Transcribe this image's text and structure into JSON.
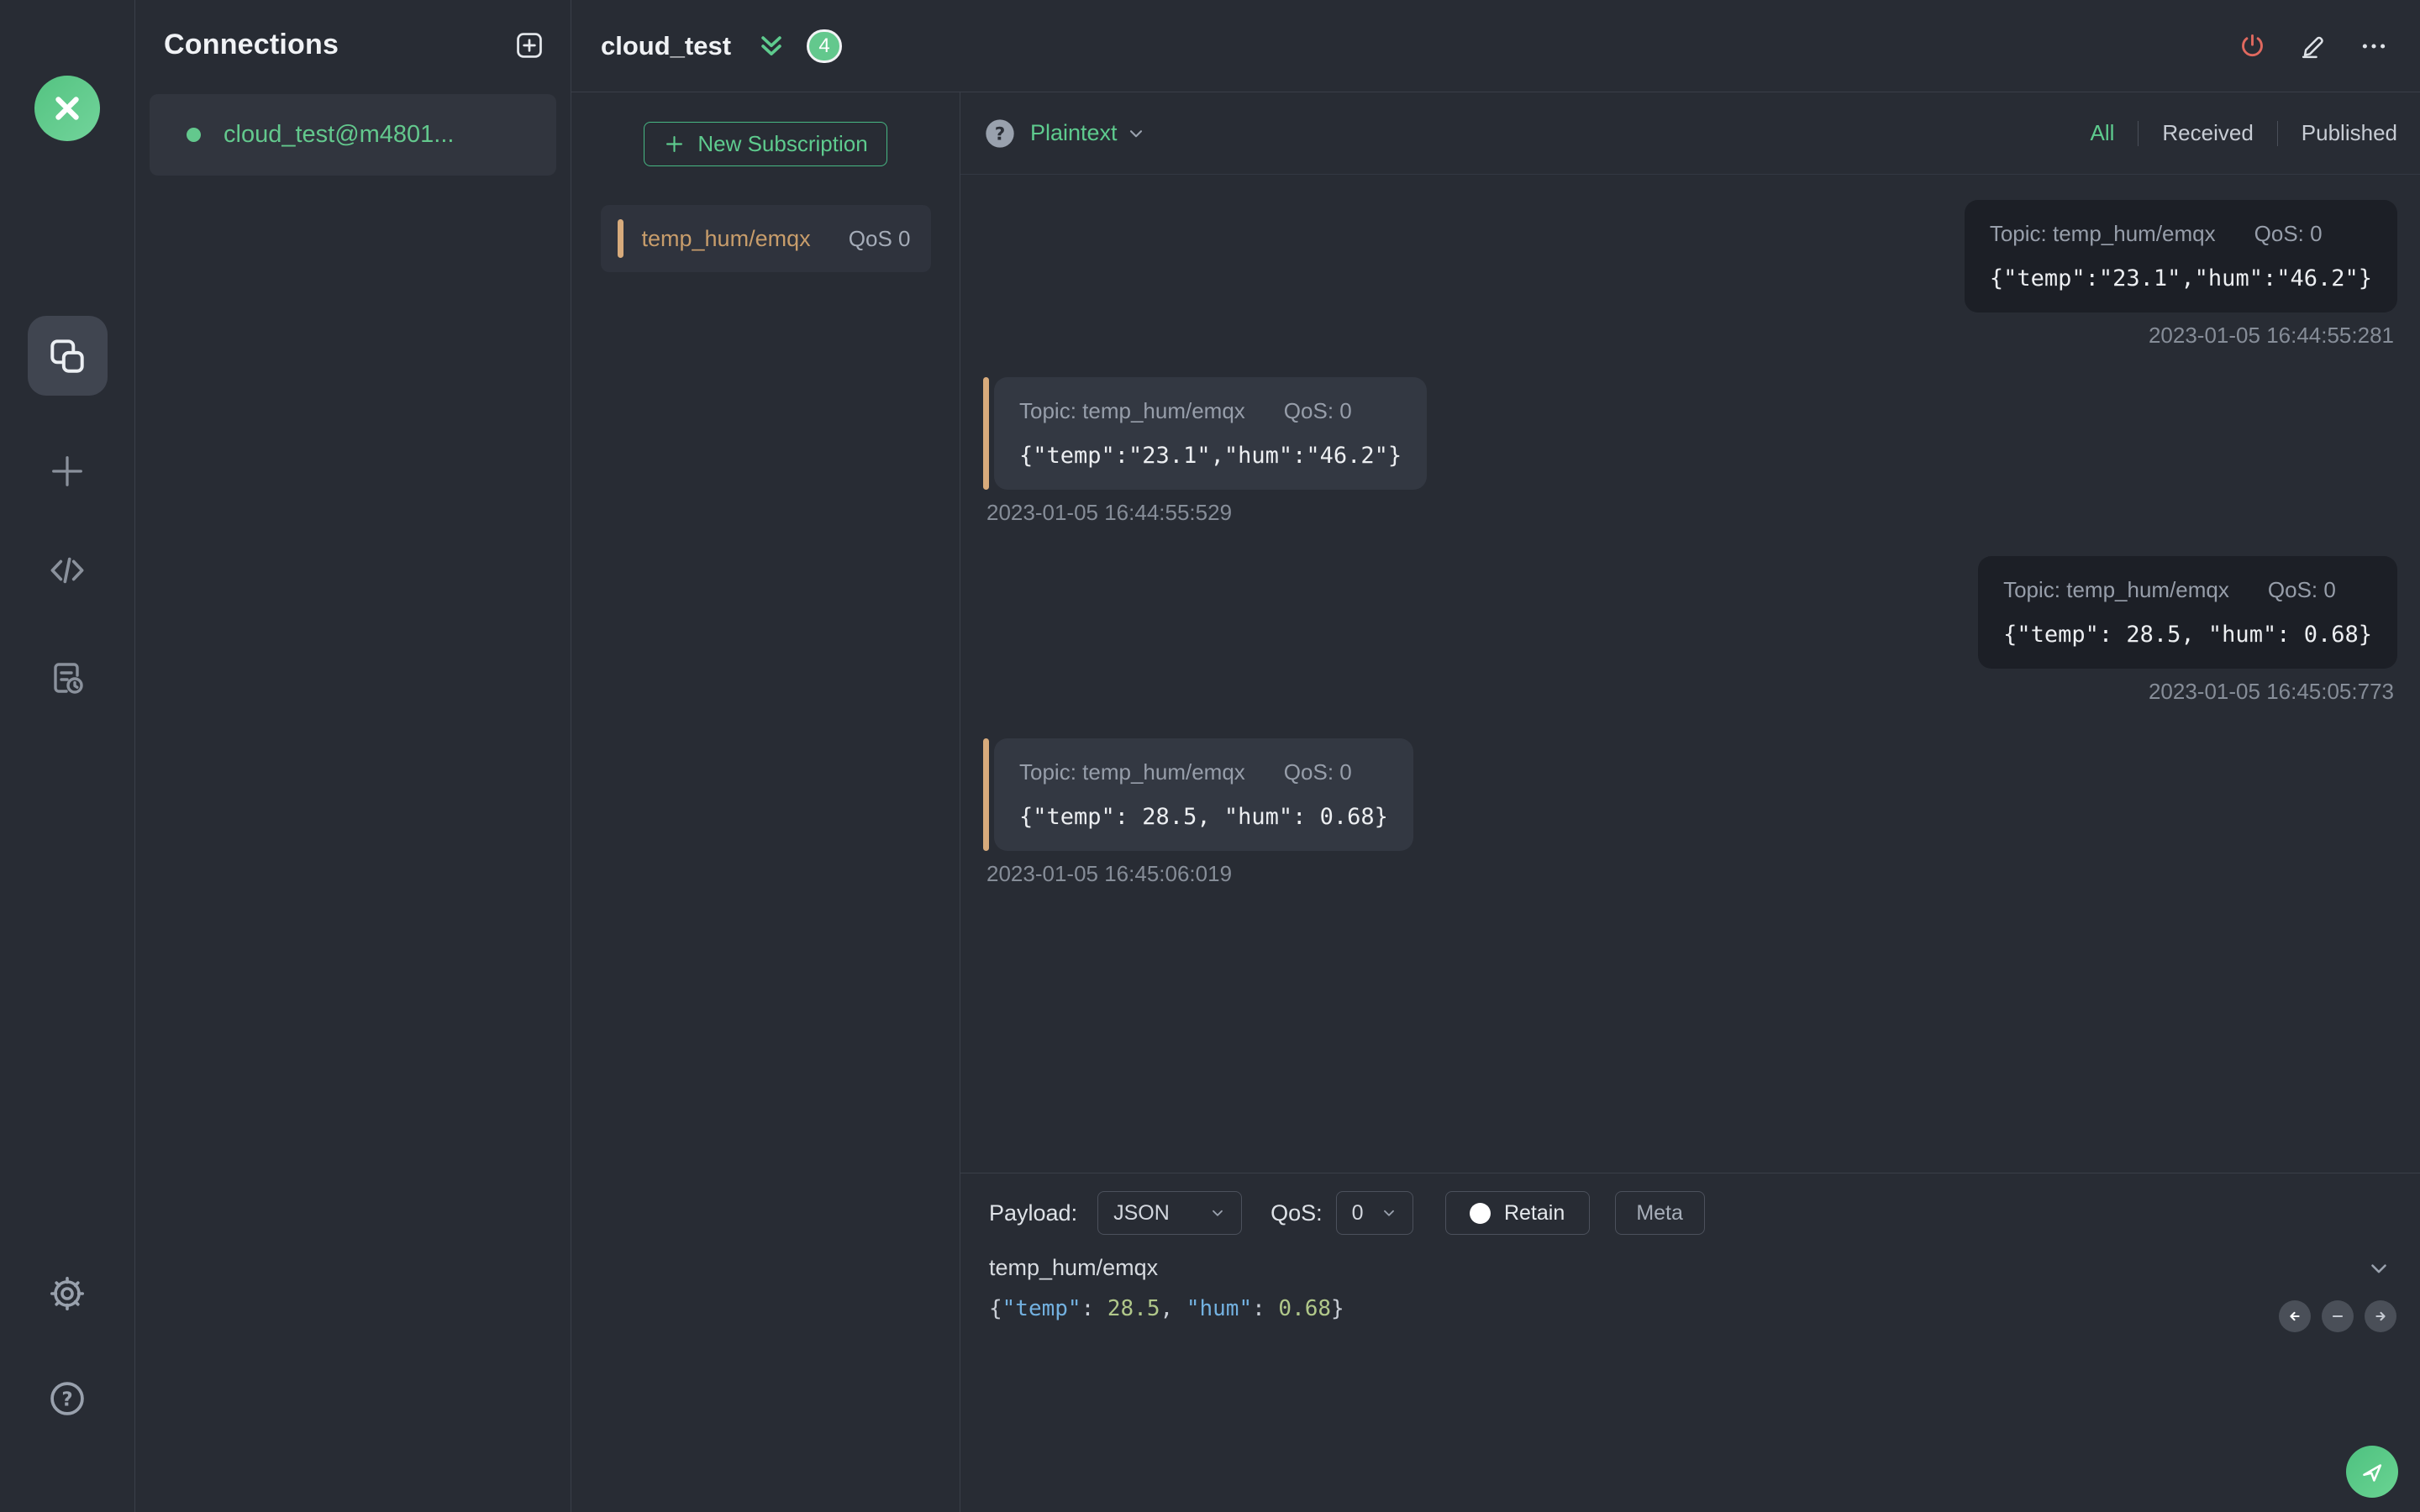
{
  "colors": {
    "accent_green": "#5ecb8e",
    "badge_green": "#63c88d",
    "accent_tan": "#d8ab7c",
    "danger_red": "#e0695f",
    "json_key_blue": "#73b1e0",
    "json_number_green": "#b1c88a",
    "bubble_published_bg": "#1c1f26",
    "bubble_received_bg": "#333842"
  },
  "icons": {
    "mqttx-logo": "x-mark-in-green-circle",
    "connections-icon": "overlapping-squares",
    "new-connection-icon": "plus",
    "scripts-icon": "code-brackets",
    "log-icon": "document-with-clock",
    "settings-icon": "gear",
    "help-icon": "question-circle",
    "disconnect-icon": "power-symbol",
    "edit-icon": "pencil-underline",
    "more-icon": "ellipsis",
    "collapse-icon": "double-chevron-down",
    "dropdown-icon": "chevron-down",
    "prev-icon": "arrow-left",
    "minus-icon": "minus",
    "next-icon": "arrow-right",
    "send-icon": "paper-plane"
  },
  "connections_panel": {
    "title": "Connections",
    "items": [
      {
        "name": "cloud_test@m4801...",
        "connected": true
      }
    ]
  },
  "header": {
    "title": "cloud_test",
    "badge_count": "4"
  },
  "subscriptions": {
    "new_button_label": "New Subscription",
    "items": [
      {
        "topic": "temp_hum/emqx",
        "qos_label": "QoS 0"
      }
    ]
  },
  "messages": {
    "format_label": "Plaintext",
    "tabs": [
      {
        "label": "All",
        "active": true
      },
      {
        "label": "Received",
        "active": false
      },
      {
        "label": "Published",
        "active": false
      }
    ],
    "items": [
      {
        "direction": "published",
        "topic_label": "Topic: temp_hum/emqx",
        "qos_label": "QoS: 0",
        "payload": "{\"temp\":\"23.1\",\"hum\":\"46.2\"}",
        "timestamp": "2023-01-05 16:44:55:281"
      },
      {
        "direction": "received",
        "topic_label": "Topic: temp_hum/emqx",
        "qos_label": "QoS: 0",
        "payload": "{\"temp\":\"23.1\",\"hum\":\"46.2\"}",
        "timestamp": "2023-01-05 16:44:55:529"
      },
      {
        "direction": "published",
        "topic_label": "Topic: temp_hum/emqx",
        "qos_label": "QoS: 0",
        "payload": "{\"temp\": 28.5, \"hum\": 0.68}",
        "timestamp": "2023-01-05 16:45:05:773"
      },
      {
        "direction": "received",
        "topic_label": "Topic: temp_hum/emqx",
        "qos_label": "QoS: 0",
        "payload": "{\"temp\": 28.5, \"hum\": 0.68}",
        "timestamp": "2023-01-05 16:45:06:019"
      }
    ]
  },
  "publish": {
    "payload_label": "Payload:",
    "payload_format": "JSON",
    "qos_label": "QoS:",
    "qos_value": "0",
    "retain_label": "Retain",
    "meta_label": "Meta",
    "topic_value": "temp_hum/emqx",
    "payload_tokens": [
      {
        "text": "{",
        "type": "punct"
      },
      {
        "text": "\"temp\"",
        "type": "key"
      },
      {
        "text": ": ",
        "type": "punct"
      },
      {
        "text": "28.5",
        "type": "number"
      },
      {
        "text": ", ",
        "type": "punct"
      },
      {
        "text": "\"hum\"",
        "type": "key"
      },
      {
        "text": ": ",
        "type": "punct"
      },
      {
        "text": "0.68",
        "type": "number"
      },
      {
        "text": "}",
        "type": "punct"
      }
    ]
  }
}
